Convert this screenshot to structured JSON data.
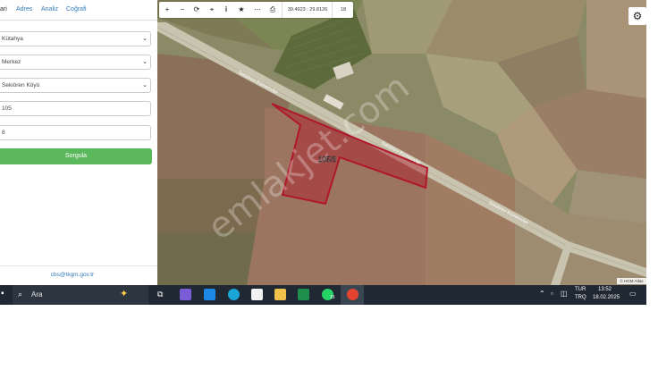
{
  "panel": {
    "tabs": [
      {
        "label": "ari",
        "active": true
      },
      {
        "label": "Adres",
        "active": false
      },
      {
        "label": "Analiz",
        "active": false
      },
      {
        "label": "Coğrafi",
        "active": false
      }
    ],
    "il": "Kütahya",
    "ilce": "Merkez",
    "mahalle": "Sekiören Köyü",
    "ada": "105",
    "parsel": "8",
    "query_button": "Sorgula",
    "contact_email": "cbs@tkgm.gov.tr"
  },
  "map": {
    "coordinates": "39.4923 : 29.8126",
    "zoom": "18",
    "parcel_label": "105/8",
    "road_label_1": "Sekiören Kümeevler",
    "road_label_2": "Sekiören Kümeevler",
    "road_label_3": "Sekiören Kümeevler",
    "watermark": "emlakjet.com",
    "attribution": "© HGM Atlas",
    "parcel_color": "#b0182a"
  },
  "toolbar": {
    "icons": [
      "zoom-in-icon",
      "zoom-out-icon",
      "refresh-icon",
      "locate-icon",
      "info-icon",
      "favorite-icon",
      "measure-icon",
      "print-icon"
    ],
    "glyphs": [
      "+",
      "−",
      "⟳",
      "⌖",
      "i",
      "★",
      "⋯",
      "⎙"
    ]
  },
  "taskbar": {
    "search_placeholder": "Ara",
    "language_top": "TUR",
    "language_bottom": "TRQ",
    "time": "13:52",
    "date": "18.02.2025",
    "whatsapp_badge": "15"
  }
}
